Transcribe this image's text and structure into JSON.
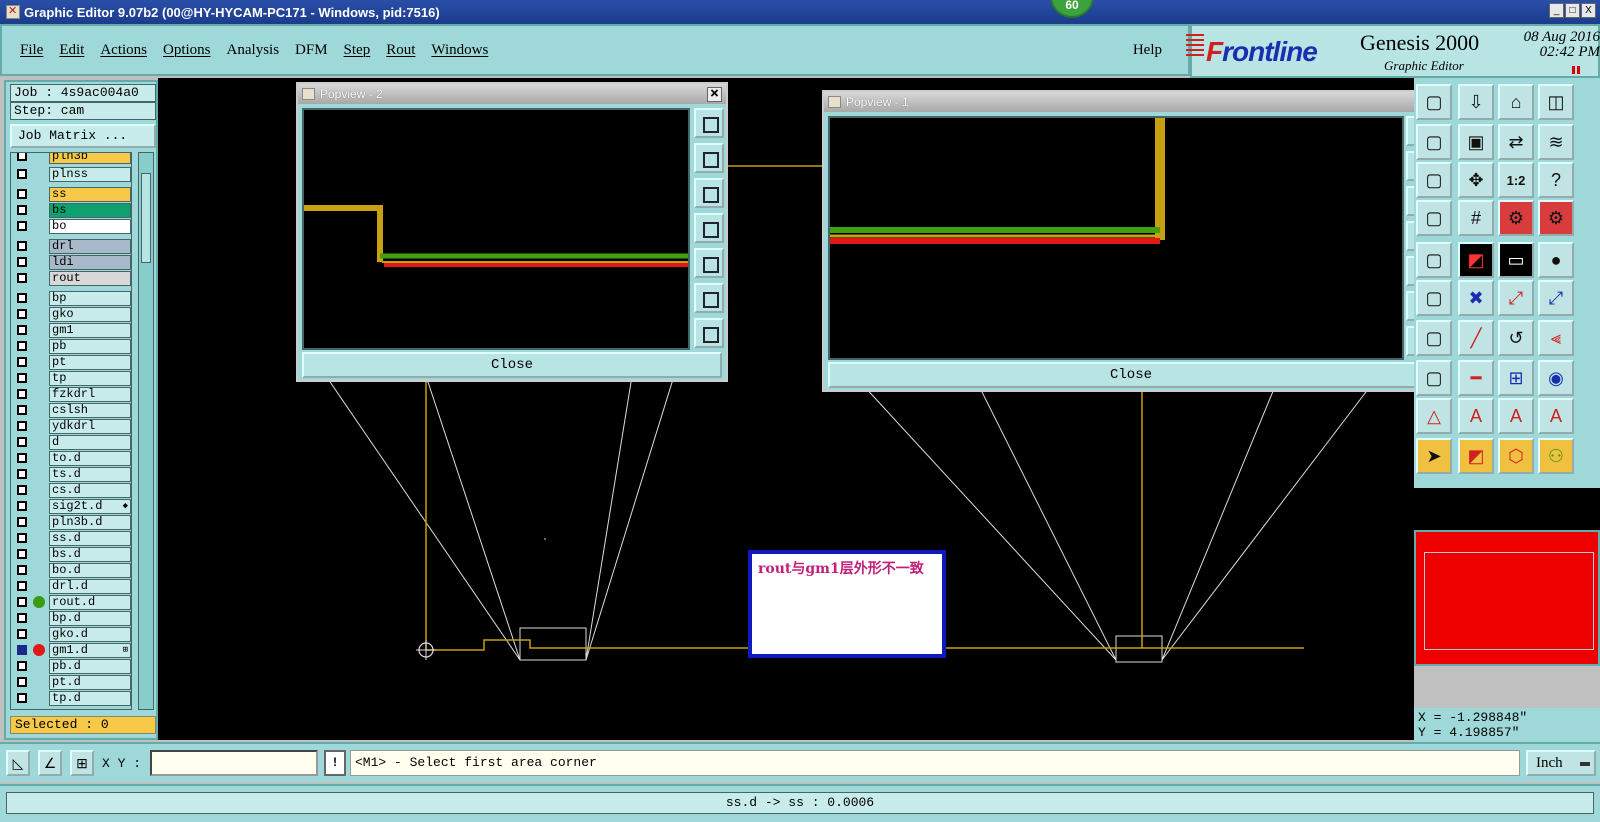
{
  "window": {
    "title": "Graphic Editor 9.07b2 (00@HY-HYCAM-PC171 - Windows, pid:7516)",
    "badge": "60",
    "buttons": [
      "_",
      "□",
      "X"
    ]
  },
  "menubar": {
    "items": [
      "File",
      "Edit",
      "Actions",
      "Options",
      "Analysis",
      "DFM",
      "Step",
      "Rout",
      "Windows"
    ],
    "help": "Help"
  },
  "brand": {
    "logo_prefix": "F",
    "logo_rest": "rontline",
    "product": "Genesis 2000",
    "subtitle": "Graphic Editor",
    "date": "08 Aug 2016",
    "time": "02:42 PM"
  },
  "left_panel": {
    "job": "Job : 4s9ac004a0",
    "step": "Step: cam",
    "job_matrix": "Job Matrix ...",
    "selected": "Selected : 0",
    "layers": [
      {
        "name": "pln3b",
        "color": "#f8c848",
        "dot": "",
        "checked": false
      },
      {
        "name": "plnss",
        "color": "#c8ecec",
        "dot": "",
        "checked": false
      },
      {
        "name": "ss",
        "color": "#f8c848",
        "dot": "",
        "checked": false
      },
      {
        "name": "bs",
        "color": "#10a070",
        "dot": "",
        "checked": false
      },
      {
        "name": "bo",
        "color": "#ffffff",
        "dot": "",
        "checked": false
      },
      {
        "name": "drl",
        "color": "#a8b8c8",
        "dot": "",
        "checked": false
      },
      {
        "name": "ldi",
        "color": "#a8b8c8",
        "dot": "",
        "checked": false
      },
      {
        "name": "rout",
        "color": "#d8d8d8",
        "dot": "",
        "checked": false
      },
      {
        "name": "bp",
        "color": "#c8ecec",
        "dot": "",
        "checked": false
      },
      {
        "name": "gko",
        "color": "#c8ecec",
        "dot": "",
        "checked": false
      },
      {
        "name": "gm1",
        "color": "#c8ecec",
        "dot": "",
        "checked": false
      },
      {
        "name": "pb",
        "color": "#c8ecec",
        "dot": "",
        "checked": false
      },
      {
        "name": "pt",
        "color": "#c8ecec",
        "dot": "",
        "checked": false
      },
      {
        "name": "tp",
        "color": "#c8ecec",
        "dot": "",
        "checked": false
      },
      {
        "name": "fzkdrl",
        "color": "#c8ecec",
        "dot": "",
        "checked": false
      },
      {
        "name": "cslsh",
        "color": "#c8ecec",
        "dot": "",
        "checked": false
      },
      {
        "name": "ydkdrl",
        "color": "#c8ecec",
        "dot": "",
        "checked": false
      },
      {
        "name": "d",
        "color": "#c8ecec",
        "dot": "",
        "checked": false
      },
      {
        "name": "to.d",
        "color": "#c8ecec",
        "dot": "",
        "checked": false
      },
      {
        "name": "ts.d",
        "color": "#c8ecec",
        "dot": "",
        "checked": false
      },
      {
        "name": "cs.d",
        "color": "#c8ecec",
        "dot": "",
        "checked": false
      },
      {
        "name": "sig2t.d",
        "color": "#c8ecec",
        "dot": "",
        "checked": false,
        "mark": "◆"
      },
      {
        "name": "pln3b.d",
        "color": "#c8ecec",
        "dot": "",
        "checked": false
      },
      {
        "name": "ss.d",
        "color": "#c8ecec",
        "dot": "",
        "checked": false
      },
      {
        "name": "bs.d",
        "color": "#c8ecec",
        "dot": "",
        "checked": false
      },
      {
        "name": "bo.d",
        "color": "#c8ecec",
        "dot": "",
        "checked": false
      },
      {
        "name": "drl.d",
        "color": "#c8ecec",
        "dot": "",
        "checked": false
      },
      {
        "name": "rout.d",
        "color": "#c8ecec",
        "dot": "#3a9a10",
        "checked": false
      },
      {
        "name": "bp.d",
        "color": "#c8ecec",
        "dot": "",
        "checked": false
      },
      {
        "name": "gko.d",
        "color": "#c8ecec",
        "dot": "",
        "checked": false
      },
      {
        "name": "gm1.d",
        "color": "#c8ecec",
        "dot": "#e01818",
        "checked": true,
        "mark": "⊞"
      },
      {
        "name": "pb.d",
        "color": "#c8ecec",
        "dot": "",
        "checked": false
      },
      {
        "name": "pt.d",
        "color": "#c8ecec",
        "dot": "",
        "checked": false
      },
      {
        "name": "tp.d",
        "color": "#c8ecec",
        "dot": "",
        "checked": false
      }
    ]
  },
  "popview2": {
    "title": "Popview - 2",
    "close": "Close"
  },
  "popview1": {
    "title": "Popview - 1",
    "close": "Close"
  },
  "note": {
    "text": "rout与gm1层外形不一致"
  },
  "coords": {
    "x": "X = -1.298848\"",
    "y": "Y =  4.198857\""
  },
  "command_bar": {
    "xy_label": "X Y :",
    "xy_value": "",
    "warn": "!",
    "prompt": "<M1> - Select first area corner",
    "units": "Inch"
  },
  "status": {
    "text": "ss.d -> ss : 0.0006"
  },
  "colors": {
    "rout": "#c8a010",
    "gm1": "#e01818",
    "green": "#40a010",
    "canvas": "#000000",
    "note_border": "#1018c0",
    "note_text": "#c0207a"
  },
  "tools": [
    "zoom-icon",
    "home-icon",
    "grid-icon",
    "pan-icon",
    "ratio-icon",
    "help-icon",
    "select-icon",
    "measure-icon",
    "snap-icon",
    "text-icon"
  ]
}
